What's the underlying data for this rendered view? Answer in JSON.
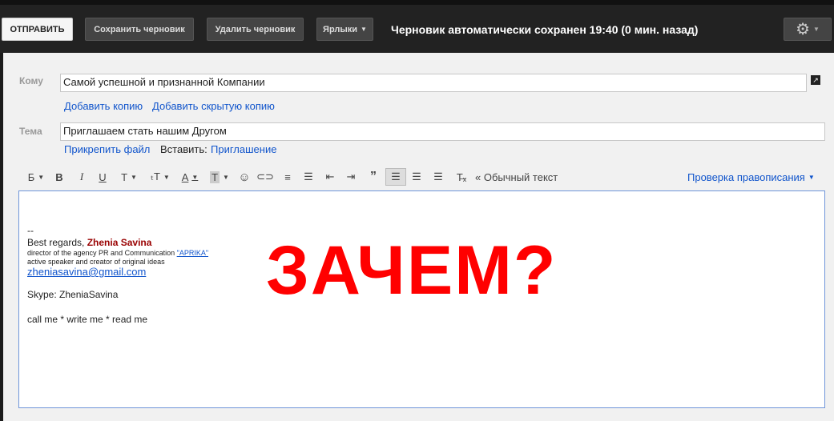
{
  "toolbar_top": {
    "send_label": "ОТПРАВИТЬ",
    "save_label": "Сохранить черновик",
    "delete_label": "Удалить черновик",
    "labels_label": "Ярлыки",
    "status": "Черновик автоматически сохранен 19:40 (0 мин. назад)"
  },
  "compose": {
    "to_label": "Кому",
    "to_value": "Самой успешной и признанной Компании",
    "add_cc": "Добавить копию",
    "add_bcc": "Добавить скрытую копию",
    "subject_label": "Тема",
    "subject_value": "Приглашаем стать нашим Другом",
    "attach": "Прикрепить файл",
    "insert_label": "Вставить:",
    "insert_invitation": "Приглашение"
  },
  "format_toolbar": {
    "font_label": "Б",
    "plain_text": "« Обычный текст",
    "spellcheck": "Проверка правописания"
  },
  "signature": {
    "dashes": "--",
    "regards": "Best regards,",
    "name": "Zhenia Savina",
    "title_line": "director of the agency PR and Communication",
    "agency": "\"APRIKA\"",
    "speaker_line": "active speaker and creator of original ideas",
    "email": "zheniasavina@gmail.com",
    "skype": "Skype: ZheniaSavina",
    "tagline": "call me * write me * read me"
  },
  "overlay_text": "ЗАЧЕМ?",
  "colors": {
    "link": "#1155cc",
    "overlay": "#ff0000",
    "signature_name": "#990000"
  }
}
